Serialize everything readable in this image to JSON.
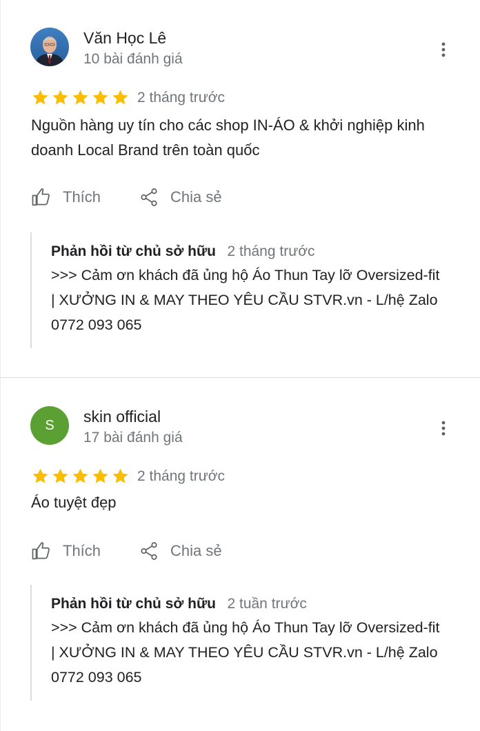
{
  "reviews": [
    {
      "reviewer": {
        "name": "Văn Học Lê",
        "review_count": "10 bài đánh giá",
        "avatar_type": "photo"
      },
      "rating": 5,
      "time": "2 tháng trước",
      "text": "Nguồn hàng uy tín cho các shop IN-ÁO & khởi nghiệp kinh doanh Local Brand trên toàn quốc",
      "actions": {
        "like_label": "Thích",
        "share_label": "Chia sẻ"
      },
      "reply": {
        "owner_label": "Phản hồi từ chủ sở hữu",
        "time": "2 tháng trước",
        "text": ">>> Cảm ơn khách đã ủng hộ Áo Thun Tay lỡ Oversized-fit | XƯỞNG IN & MAY THEO YÊU CẦU STVR.vn - L/hệ Zalo 0772 093 065"
      }
    },
    {
      "reviewer": {
        "name": "skin official",
        "review_count": "17 bài đánh giá",
        "avatar_letter": "S",
        "avatar_color": "#5ba033"
      },
      "rating": 5,
      "time": "2 tháng trước",
      "text": "Áo tuyệt đẹp",
      "actions": {
        "like_label": "Thích",
        "share_label": "Chia sẻ"
      },
      "reply": {
        "owner_label": "Phản hồi từ chủ sở hữu",
        "time": "2 tuần trước",
        "text": ">>> Cảm ơn khách đã ủng hộ Áo Thun Tay lỡ Oversized-fit | XƯỞNG IN & MAY THEO YÊU CẦU STVR.vn - L/hệ Zalo 0772 093 065"
      }
    }
  ],
  "colors": {
    "star": "#fbbc04",
    "secondary_text": "#70757a",
    "primary_text": "#202124",
    "divider": "#dadce0"
  },
  "icons": {
    "more": "more-vert-icon",
    "like": "thumb-up-icon",
    "share": "share-icon",
    "star": "star-icon"
  }
}
